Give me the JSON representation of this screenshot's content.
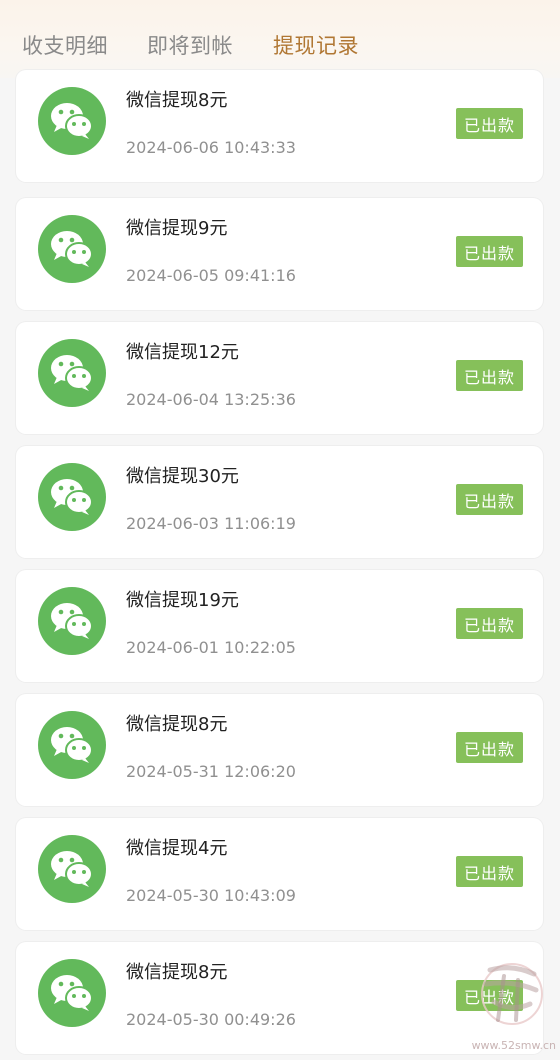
{
  "tabs": [
    {
      "label": "收支明细",
      "active": false
    },
    {
      "label": "即将到帐",
      "active": false
    },
    {
      "label": "提现记录",
      "active": true
    }
  ],
  "records": [
    {
      "title": "微信提现8元",
      "time": "2024-06-06 10:43:33",
      "status": "已出款",
      "icon": "wechat-icon"
    },
    {
      "title": "微信提现9元",
      "time": "2024-06-05 09:41:16",
      "status": "已出款",
      "icon": "wechat-icon"
    },
    {
      "title": "微信提现12元",
      "time": "2024-06-04 13:25:36",
      "status": "已出款",
      "icon": "wechat-icon"
    },
    {
      "title": "微信提现30元",
      "time": "2024-06-03 11:06:19",
      "status": "已出款",
      "icon": "wechat-icon"
    },
    {
      "title": "微信提现19元",
      "time": "2024-06-01 10:22:05",
      "status": "已出款",
      "icon": "wechat-icon"
    },
    {
      "title": "微信提现8元",
      "time": "2024-05-31 12:06:20",
      "status": "已出款",
      "icon": "wechat-icon"
    },
    {
      "title": "微信提现4元",
      "time": "2024-05-30 10:43:09",
      "status": "已出款",
      "icon": "wechat-icon"
    },
    {
      "title": "微信提现8元",
      "time": "2024-05-30 00:49:26",
      "status": "已出款",
      "icon": "wechat-icon"
    }
  ],
  "watermark": {
    "text": "www.52smw.cn"
  },
  "colors": {
    "accent": "#b07733",
    "wechat_green": "#62b95b",
    "badge_green": "#86c05a",
    "page_bg": "#f6f6f6"
  }
}
